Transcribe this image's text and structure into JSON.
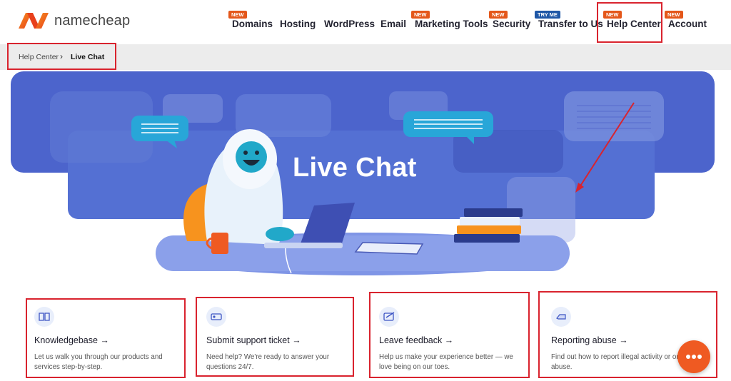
{
  "brand": {
    "name": "namecheap",
    "accent": "#f05a22"
  },
  "nav": {
    "items": [
      {
        "label": "Domains",
        "badge": "NEW"
      },
      {
        "label": "Hosting",
        "badge": ""
      },
      {
        "label": "WordPress",
        "badge": ""
      },
      {
        "label": "Email",
        "badge": ""
      },
      {
        "label": "Marketing Tools",
        "badge": "NEW"
      },
      {
        "label": "Security",
        "badge": "NEW"
      },
      {
        "label": "Transfer to Us",
        "badge": "TRY ME"
      },
      {
        "label": "Help Center",
        "badge": "NEW"
      },
      {
        "label": "Account",
        "badge": "NEW"
      }
    ]
  },
  "breadcrumb": {
    "parent": "Help Center",
    "separator": "›",
    "current": "Live Chat"
  },
  "hero": {
    "title": "Live Chat",
    "bg_color": "#4c64cc"
  },
  "cards": [
    {
      "title": "Knowledgebase →",
      "desc": "Let us walk you through our products and services step-by-step.",
      "icon": "book-icon"
    },
    {
      "title": "Submit support ticket →",
      "desc": "Need help? We're ready to answer your questions 24/7.",
      "icon": "ticket-icon"
    },
    {
      "title": "Leave feedback →",
      "desc": "Help us make your experience better — we love being on our toes.",
      "icon": "feedback-icon"
    },
    {
      "title": "Reporting abuse →",
      "desc": "Find out how to report illegal activity or online abuse.",
      "icon": "flag-icon"
    }
  ],
  "annotation_color": "#d9232e",
  "chat_widget": {
    "icon": "chat-bubble-icon",
    "color": "#ef5a22"
  }
}
